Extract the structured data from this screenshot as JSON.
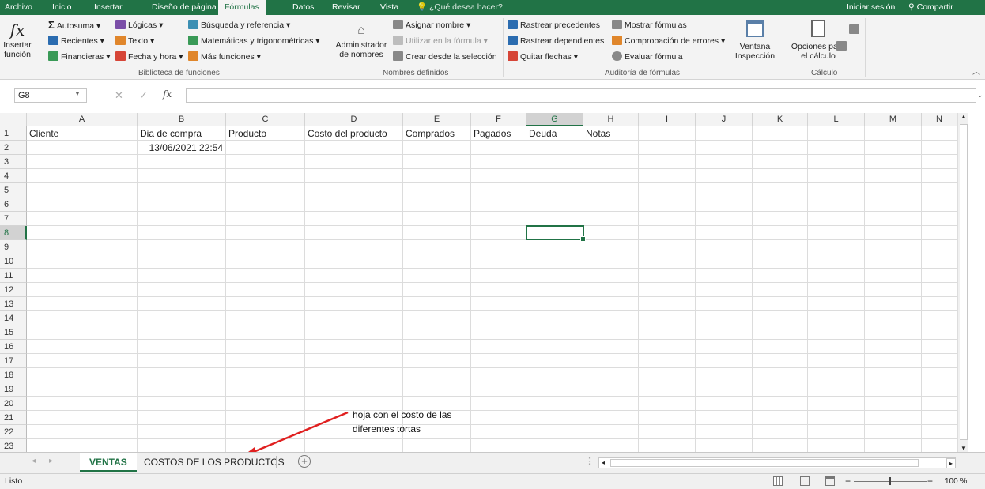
{
  "menu": {
    "tabs": [
      "Archivo",
      "Inicio",
      "Insertar",
      "Diseño de página",
      "Fórmulas",
      "Datos",
      "Revisar",
      "Vista"
    ],
    "active_tab": "Fórmulas",
    "tell_me": "¿Qué desea hacer?",
    "sign_in": "Iniciar sesión",
    "share": "Compartir"
  },
  "ribbon": {
    "insert_function": [
      "Insertar",
      "función"
    ],
    "autosum": "Autosuma",
    "recent": "Recientes",
    "financial": "Financieras",
    "logical": "Lógicas",
    "text": "Texto",
    "datetime": "Fecha y hora",
    "lookup": "Búsqueda y referencia",
    "math": "Matemáticas y trigonométricas",
    "more": "Más funciones",
    "group_library": "Biblioteca de funciones",
    "name_manager": [
      "Administrador",
      "de nombres"
    ],
    "define_name": "Asignar nombre",
    "use_in_formula": "Utilizar en la fórmula",
    "create_from_sel": "Crear desde la selección",
    "group_names": "Nombres definidos",
    "trace_precedents": "Rastrear precedentes",
    "trace_dependents": "Rastrear dependientes",
    "remove_arrows": "Quitar flechas",
    "show_formulas": "Mostrar fórmulas",
    "error_check": "Comprobación de errores",
    "evaluate": "Evaluar fórmula",
    "group_audit": "Auditoría de fórmulas",
    "watch_window": [
      "Ventana",
      "Inspección"
    ],
    "calc_options": [
      "Opciones para",
      "el cálculo"
    ],
    "group_calc": "Cálculo"
  },
  "formula_bar": {
    "name_box": "G8",
    "fx": "fx",
    "value": ""
  },
  "columns": [
    "A",
    "B",
    "C",
    "D",
    "E",
    "F",
    "G",
    "H",
    "I",
    "J",
    "K",
    "L",
    "M",
    "N"
  ],
  "selected_column": "G",
  "selected_row": 8,
  "rows": [
    "1",
    "2",
    "3",
    "4",
    "5",
    "6",
    "7",
    "8",
    "9",
    "10",
    "11",
    "12",
    "13",
    "14",
    "15",
    "16",
    "17",
    "18",
    "19",
    "20",
    "21",
    "22",
    "23"
  ],
  "headers_row": [
    "Cliente",
    "Dia de compra",
    "Producto",
    "Costo del producto",
    "Comprados",
    "Pagados",
    "Deuda",
    "Notas"
  ],
  "row2_date": "13/06/2021 22:54",
  "sheet_tabs": [
    "VENTAS",
    "COSTOS DE LOS PRODUCTOS"
  ],
  "active_sheet": "VENTAS",
  "annotation": [
    "hoja con el costo de las",
    "diferentes tortas"
  ],
  "status": {
    "text": "Listo",
    "zoom": "100 %"
  },
  "colors": {
    "accent": "#217346",
    "arrow": "#e02020"
  }
}
